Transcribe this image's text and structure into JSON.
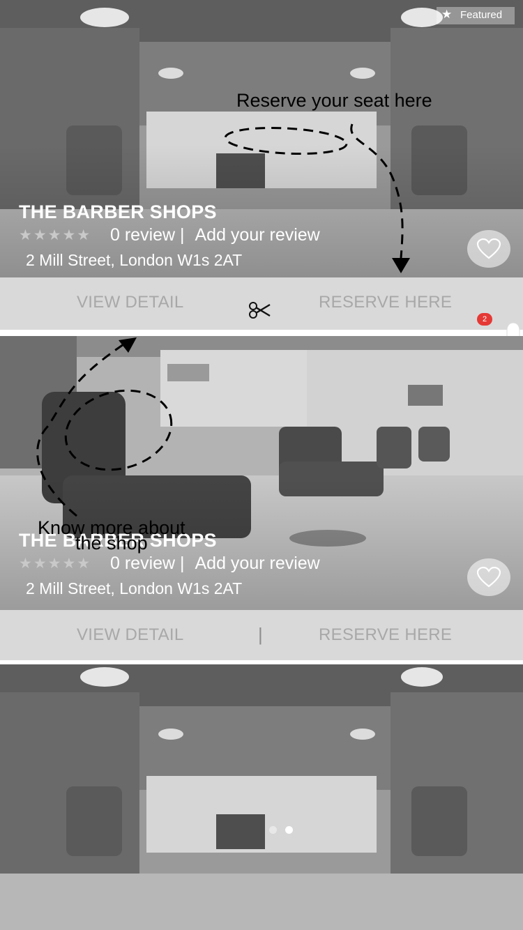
{
  "featured_label": "Featured",
  "listings": [
    {
      "title": "THE BARBER SHOPS",
      "rating_stars": 0,
      "reviews_text": "0 review |",
      "add_review": "Add your review",
      "address": "2 Mill Street, London W1s 2AT",
      "view_detail": "VIEW DETAIL",
      "reserve": "RESERVE HERE"
    },
    {
      "title": "THE BARBER SHOPS",
      "rating_stars": 0,
      "reviews_text": "0 review |",
      "add_review": "Add your review",
      "address": "2 Mill Street, London W1s 2AT",
      "view_detail": "VIEW DETAIL",
      "separator": "|",
      "reserve": "RESERVE HERE"
    }
  ],
  "annotations": {
    "reserve_tip": "Reserve your seat here",
    "know_more_tip_line1": "Know more about",
    "know_more_tip_line2": "the shop"
  },
  "notification_count": "2",
  "carousel": {
    "dot_count": 2,
    "active_index": 1
  },
  "icons": [
    "star-icon",
    "heart-icon",
    "scissors-icon",
    "bell-icon"
  ]
}
